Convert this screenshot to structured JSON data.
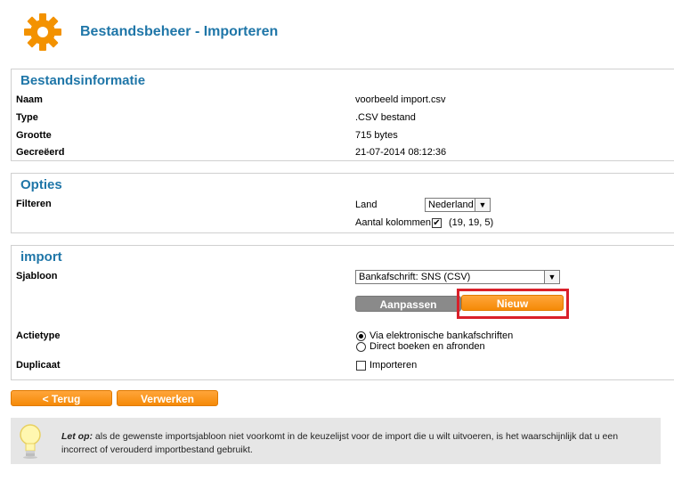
{
  "header": {
    "title": "Bestandsbeheer - Importeren",
    "icon": "gear-icon"
  },
  "file_info": {
    "heading": "Bestandsinformatie",
    "rows": [
      {
        "label": "Naam",
        "value": "voorbeeld import.csv"
      },
      {
        "label": "Type",
        "value": ".CSV bestand"
      },
      {
        "label": "Grootte",
        "value": "715 bytes"
      },
      {
        "label": "Gecreëerd",
        "value": "21-07-2014 08:12:36"
      }
    ]
  },
  "options": {
    "heading": "Opties",
    "filter_label": "Filteren",
    "land_label": "Land",
    "land_value": "Nederland",
    "columns_label": "Aantal kolommen",
    "columns_checked": true,
    "columns_value": "(19, 19, 5)"
  },
  "import": {
    "heading": "import",
    "template_label": "Sjabloon",
    "template_value": "Bankafschrift: SNS (CSV)",
    "edit_button": "Aanpassen",
    "new_button": "Nieuw",
    "action_label": "Actietype",
    "action_options": [
      "Via elektronische bankafschriften",
      "Direct boeken en afronden"
    ],
    "action_selected": 0,
    "duplicate_label": "Duplicaat",
    "duplicate_option": "Importeren"
  },
  "footer": {
    "back_button": "< Terug",
    "process_button": "Verwerken"
  },
  "tip": {
    "icon": "lightbulb-icon",
    "prefix": "Let op:",
    "text": " als de gewenste importsjabloon niet voorkomt in de keuzelijst voor de import die u wilt uitvoeren, is het waarschijnlijk dat u een incorrect of verouderd importbestand gebruikt."
  },
  "colors": {
    "accent": "#1f76a8",
    "orange": "#f58a07",
    "highlight": "#d9202a"
  }
}
